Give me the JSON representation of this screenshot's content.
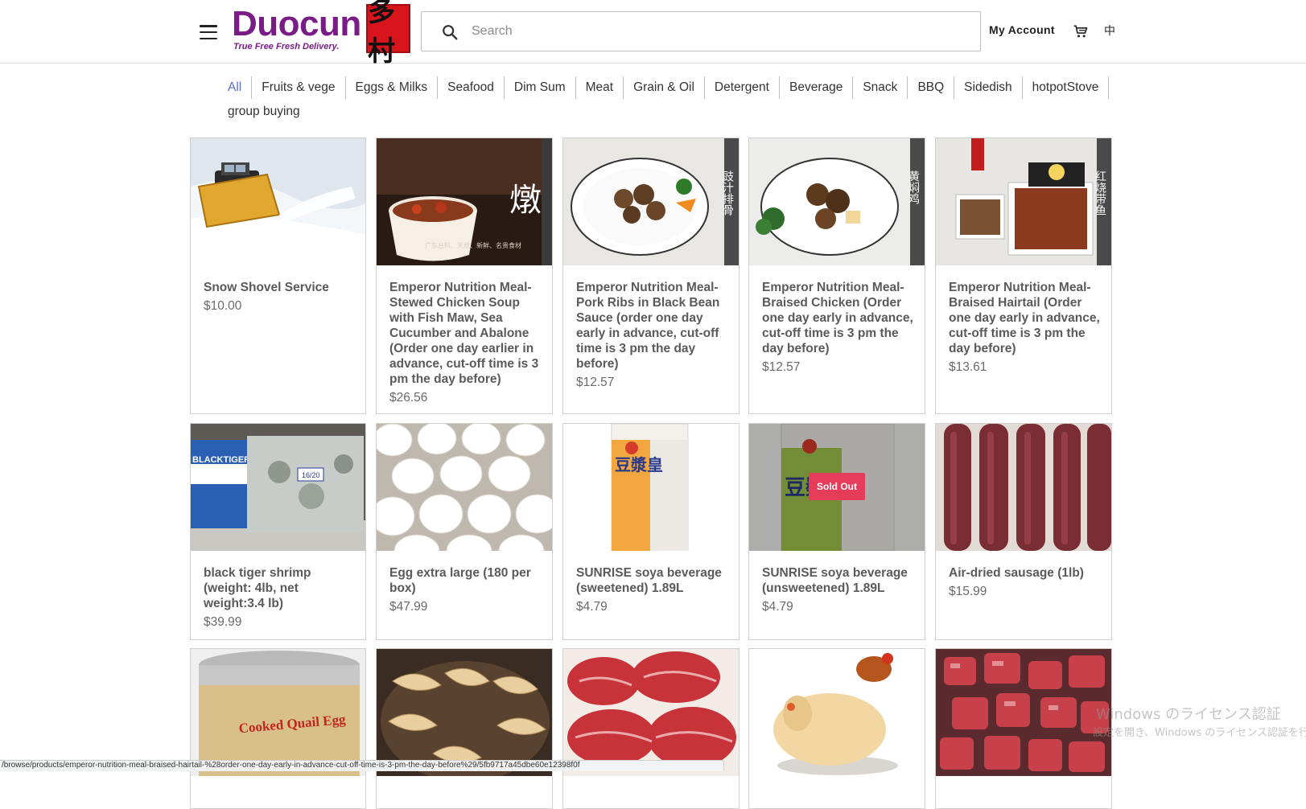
{
  "header": {
    "logo_text": "Duocun",
    "logo_tagline": "True Free Fresh Delivery.",
    "logo_seal": "多村",
    "search_placeholder": "Search",
    "account_label": "My Account",
    "lang_label": "中"
  },
  "categories": [
    {
      "label": "All",
      "active": true
    },
    {
      "label": "Fruits & vege"
    },
    {
      "label": "Eggs & Milks"
    },
    {
      "label": "Seafood"
    },
    {
      "label": "Dim Sum"
    },
    {
      "label": "Meat"
    },
    {
      "label": "Grain & Oil"
    },
    {
      "label": "Detergent"
    },
    {
      "label": "Beverage"
    },
    {
      "label": "Snack"
    },
    {
      "label": "BBQ"
    },
    {
      "label": "Sidedish"
    },
    {
      "label": "hotpotStove"
    },
    {
      "label": "group buying"
    }
  ],
  "products": [
    {
      "name": "Snow Shovel Service",
      "price": "$10.00",
      "image": "snow-plow-truck"
    },
    {
      "name": "Emperor Nutrition Meal-Stewed Chicken Soup with Fish Maw, Sea Cucumber and Abalone (Order one day earlier in advance, cut-off time is 3 pm the day before)",
      "price": "$26.56",
      "image": "chicken-soup-bowl",
      "image_text": "燉",
      "image_caption": "广东台料、天然、新鲜、名贵食材"
    },
    {
      "name": "Emperor Nutrition Meal-Pork Ribs in Black Bean Sauce (order one day early in advance, cut-off time is 3 pm the day before)",
      "price": "$12.57",
      "image": "pork-ribs-plate",
      "image_text": "豉汁排骨"
    },
    {
      "name": "Emperor Nutrition Meal-Braised Chicken (Order one day early in advance, cut-off time is 3 pm the day before)",
      "price": "$12.57",
      "image": "braised-chicken-plate",
      "image_text": "黄焖鸡"
    },
    {
      "name": "Emperor Nutrition Meal-Braised Hairtail (Order one day early in advance, cut-off time is 3 pm the day before)",
      "price": "$13.61",
      "image": "braised-hairtail-tray",
      "image_text": "红烧带鱼"
    },
    {
      "name": "black tiger shrimp (weight: 4lb, net weight:3.4 lb)",
      "price": "$39.99",
      "image": "frozen-shrimp-box",
      "image_text": "BLACKTIGER",
      "image_tag": "16/20"
    },
    {
      "name": "Egg extra large (180 per box)",
      "price": "$47.99",
      "image": "eggs-tray"
    },
    {
      "name": "SUNRISE soya beverage (sweetened) 1.89L",
      "price": "$4.79",
      "image": "soya-carton-orange",
      "image_text": "豆漿皇"
    },
    {
      "name": "SUNRISE soya beverage (unsweetened) 1.89L",
      "price": "$4.79",
      "image": "soya-carton-green",
      "image_text": "豆漿皇",
      "sold_out": true,
      "badge": "Sold Out"
    },
    {
      "name": "Air-dried sausage (1lb)",
      "price": "$15.99",
      "image": "air-dried-sausage"
    },
    {
      "name": "",
      "price": "",
      "image": "quail-egg-can",
      "image_text": "Cooked Quail Egg"
    },
    {
      "name": "",
      "price": "",
      "image": "dumplings-pan"
    },
    {
      "name": "",
      "price": "",
      "image": "sliced-beef"
    },
    {
      "name": "",
      "price": "",
      "image": "whole-chicken"
    },
    {
      "name": "",
      "price": "",
      "image": "beef-cubes"
    }
  ],
  "watermark": {
    "line1": "Windows のライセンス認証",
    "line2": "設定を開き、Windows のライセンス認証を行"
  },
  "status_url": "/browse/products/emperor-nutrition-meal-braised-hairtail-%28order-one-day-early-in-advance-cut-off-time-is-3-pm-the-day-before%29/5fb9717a45dbe60e12398f0f"
}
